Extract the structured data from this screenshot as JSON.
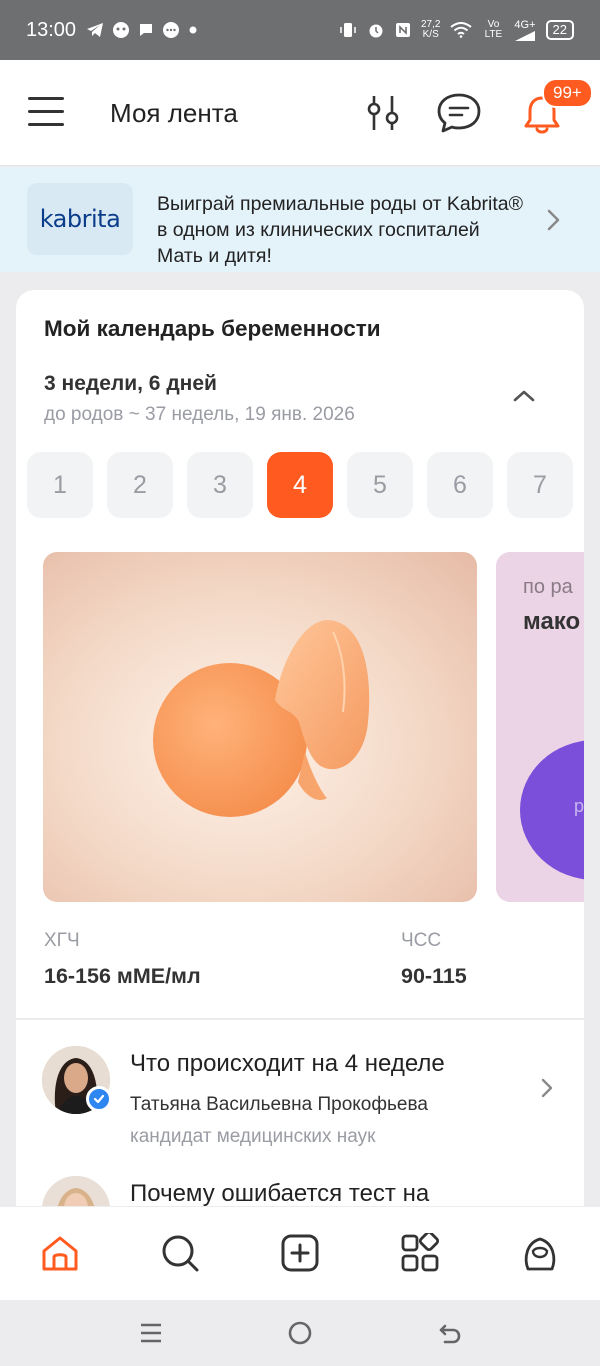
{
  "status_bar": {
    "time": "13:00",
    "net_speed_value": "27,2",
    "net_speed_unit": "K/S",
    "volte": "Vo LTE",
    "signal": "4G+",
    "battery": "22",
    "icons_left": [
      "telegram-icon",
      "app-icon",
      "message-icon",
      "chat-bubble-icon",
      "dot-icon"
    ],
    "icons_right": [
      "vibrate-icon",
      "alarm-icon",
      "nfc-icon",
      "wifi-icon",
      "cellular-icon",
      "battery-icon"
    ]
  },
  "header": {
    "title": "Моя лента",
    "notifications_badge": "99+",
    "accent_color": "#ff5a1f"
  },
  "promo": {
    "logo_text": "kabrita",
    "text": "Выиграй премиальные роды от Kabrita® в одном из клинических госпиталей Мать и дитя!"
  },
  "calendar": {
    "title": "Мой календарь беременности",
    "current": "3 недели, 6 дней",
    "due": "до родов ~ 37 недель, 19 янв. 2026",
    "weeks": [
      "1",
      "2",
      "3",
      "4",
      "5",
      "6",
      "7"
    ],
    "active_week": "4",
    "second_slide": {
      "line1": "по ра",
      "line2": "мако",
      "line3": "р"
    },
    "metrics": [
      {
        "label": "ХГЧ",
        "value": "16-156 мМЕ/мл"
      },
      {
        "label": "ЧСС",
        "value": "90-115"
      }
    ]
  },
  "articles": [
    {
      "title": "Что происходит на 4 неделе",
      "author": "Татьяна Васильевна Прокофьева",
      "role": "кандидат медицинских наук"
    },
    {
      "title": "Почему ошибается тест на"
    }
  ],
  "bottom_nav": [
    "home-icon",
    "search-icon",
    "add-icon",
    "services-icon",
    "profile-icon"
  ]
}
